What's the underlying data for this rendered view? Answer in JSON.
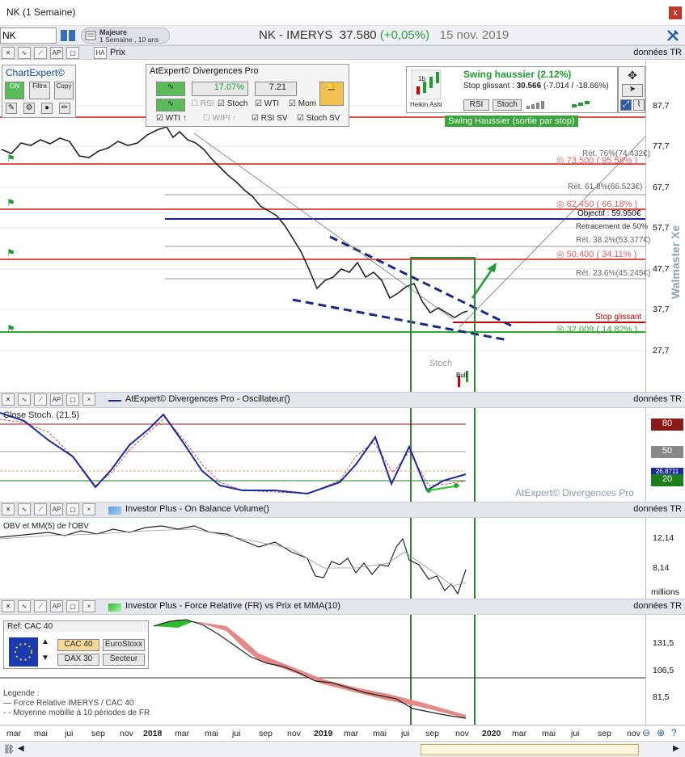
{
  "window": {
    "title": "NK (1 Semaine)",
    "close": "x"
  },
  "header": {
    "symbol": "NK",
    "list_name": "Majeure",
    "list_sub": "1 Semaine , 10 ans",
    "instrument": "NK - IMERYS",
    "price": "37.580",
    "change": "(+0,05%)",
    "date": "15 nov. 2019"
  },
  "price_pane": {
    "label": "Prix",
    "right_label": "données TR",
    "y_ticks": [
      "87,7",
      "77,7",
      "67,7",
      "57,7",
      "47,7",
      "37,7",
      "27,7"
    ],
    "levels": [
      {
        "text": "Rét. 76%(74.432€)",
        "color": "#666666"
      },
      {
        "text": "◎ 73.500 ( 95.58% )",
        "color": "#e06060"
      },
      {
        "text": "Rét. 61.8%(66.523€)",
        "color": "#666666"
      },
      {
        "text": "◎ 62.450 ( 66.18% )",
        "color": "#e06060"
      },
      {
        "text": "Objectif : 59.950€",
        "color": "#000000"
      },
      {
        "text": "Retracement de 50%",
        "color": "#333333"
      },
      {
        "text": "Rét. 38.2%(53.377€)",
        "color": "#666666"
      },
      {
        "text": "◎ 50.400 ( 34.11% )",
        "color": "#e06060"
      },
      {
        "text": "Rét. 23.6%(45.245€)",
        "color": "#666666"
      },
      {
        "text": "Stop glissant",
        "color": "#cc0000"
      },
      {
        "text": "◎ 32.009 ( 14.82% )",
        "color": "#2eaa2e"
      }
    ],
    "annotations": {
      "stoch": "Stoch",
      "bull": "Bull",
      "watermark": "Walmaster Xe"
    }
  },
  "chartexpert": {
    "title": "ChartExpert©",
    "buttons": [
      "ON",
      "Filtre",
      "Copy"
    ]
  },
  "divergences": {
    "title": "AtExpert© Divergences Pro",
    "pct": "17.07%",
    "val": "7.21",
    "checks": [
      {
        "label": "RSI",
        "checked": false
      },
      {
        "label": "Stoch",
        "checked": true
      },
      {
        "label": "WTI",
        "checked": true
      },
      {
        "label": "Mom",
        "checked": true
      },
      {
        "label": "WTI",
        "checked": true
      },
      {
        "label": "WIPI",
        "checked": false
      },
      {
        "label": "RSI SV",
        "checked": true
      },
      {
        "label": "Stoch SV",
        "checked": true
      }
    ]
  },
  "swing": {
    "title": "Swing haussier (2.12%)",
    "stop_label": "Stop glissant :",
    "stop_value": "30.566",
    "stop_detail": "(-7.014 / -18.66%)",
    "heikin": "Heikin Ashi",
    "tag_1b": "1b",
    "btn_rsi": "RSI",
    "btn_stoch": "Stoch",
    "banner": "Swing Haussier (sortie par stop)"
  },
  "osc_pane": {
    "title": "AtExpert© Divergences Pro - Oscillateur()",
    "right_label": "données TR",
    "series_label": "Close Stoch. (21,5)",
    "levels": [
      "80",
      "50",
      "20"
    ],
    "value_box": "26.8711",
    "watermark": "AtExpert© Divergences Pro"
  },
  "obv_pane": {
    "title": "Investor Plus - On Balance Volume()",
    "right_label": "données TR",
    "series_label": "OBV et MM(5) de l'OBV",
    "y_ticks": [
      "12,14",
      "8,14"
    ],
    "unit": "millions"
  },
  "fr_pane": {
    "title": "Investor Plus - Force Relative (FR) vs Prix et MMA(10)",
    "right_label": "données TR",
    "y_ticks": [
      "131,5",
      "106,5",
      "81,5"
    ],
    "ref_label": "Ref: CAC 40",
    "indices": [
      "CAC 40",
      "EuroStoxx",
      "DAX 30",
      "Secteur"
    ],
    "legend_title": "Legende :",
    "legend_1": "Force Relative IMERYS / CAC 40",
    "legend_2": "Moyenne mobille à 10 périodes de FR"
  },
  "x_axis": [
    "mar",
    "mai",
    "jui",
    "sep",
    "nov",
    "2018",
    "mar",
    "mai",
    "jui",
    "sep",
    "nov",
    "2019",
    "mar",
    "mai",
    "jui",
    "sep",
    "nov",
    "2020",
    "mar",
    "mai",
    "jui",
    "sep",
    "nov"
  ]
}
